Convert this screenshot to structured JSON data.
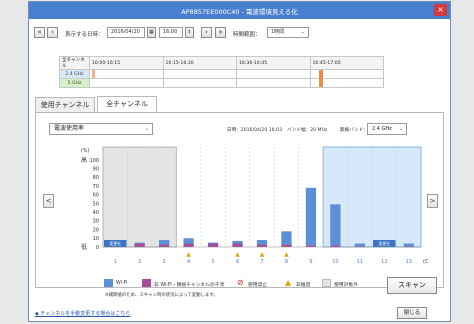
{
  "window": {
    "title": "AP8857EE000C40 - 電波環境見える化",
    "close_glyph": "×"
  },
  "toolbar": {
    "first_glyph": "«",
    "prev_glyph": "‹",
    "display_datetime_label": "表示する日時：",
    "date_value": "2016/04/20",
    "time_value": "16:00",
    "next_glyph": "›",
    "last_glyph": "»",
    "time_range_label": "時間範囲：",
    "time_range_value": "1時間"
  },
  "timeline": {
    "header_label": "全チャンネル",
    "time_slots": [
      "16:00-16:15",
      "16:15-16:30",
      "16:30-16:45",
      "16:45-17:00"
    ],
    "rows": [
      {
        "label": "2.4 GHz",
        "marker_color": "#f5b08a"
      },
      {
        "label": "5 GHz",
        "marker_color": "#f08a4b"
      }
    ]
  },
  "tabs": [
    {
      "label": "使用チャンネル",
      "active": false
    },
    {
      "label": "全チャンネル",
      "active": true
    }
  ],
  "panel": {
    "metric_select": "電波使用率",
    "date_info": "日時：2016/04/20 16:03",
    "bandwidth_info": "バンド幅：20 MHz",
    "band_label": "無線バンド：",
    "band_value": "2.4 GHz",
    "left_arrow": "<",
    "right_arrow": ">"
  },
  "chart_data": {
    "type": "bar",
    "ylabel": "(%)",
    "y_top_label": "高",
    "y_bottom_label": "低",
    "xunit": "(Ch)",
    "ylim": [
      0,
      100
    ],
    "yticks": [
      0,
      10,
      20,
      30,
      40,
      50,
      60,
      70,
      80,
      90,
      100
    ],
    "categories": [
      "1",
      "2",
      "3",
      "4",
      "5",
      "6",
      "7",
      "8",
      "9",
      "10",
      "11",
      "12",
      "13"
    ],
    "series": [
      {
        "name": "Wi-Fi",
        "color": "#5b8fd6",
        "values": [
          3,
          1,
          5,
          6,
          1,
          3,
          5,
          15,
          66,
          47,
          3,
          4,
          3
        ]
      },
      {
        "name": "非Wi-Fi・隣接チャンネルの干渉",
        "color": "#a34e9a",
        "values": [
          3,
          4,
          3,
          4,
          4,
          4,
          3,
          3,
          2,
          2,
          1,
          2,
          1
        ]
      }
    ],
    "warnings_at": [
      "4",
      "6",
      "7",
      "8"
    ],
    "selected_labels": [
      {
        "channel": "1",
        "text": "変更先"
      },
      {
        "channel": "12",
        "text": "変更先"
      }
    ],
    "shaded_left": [
      "1",
      "2",
      "3"
    ],
    "shaded_right": [
      "10",
      "11",
      "12",
      "13"
    ]
  },
  "legend": {
    "wifi": "Wi-Fi",
    "non_wifi": "非 Wi-Fi・隣接チャンネルの干渉",
    "prohibited": "使用禁止",
    "warning": "非推奨",
    "out_of_range": "使用対象外",
    "note": "※補間値のため、スキャン時の状況によって変動します。"
  },
  "buttons": {
    "scan": "スキャン",
    "close": "閉じる"
  },
  "footer": {
    "link": "◆ チャンネルを手動変更する場合はこちら"
  }
}
